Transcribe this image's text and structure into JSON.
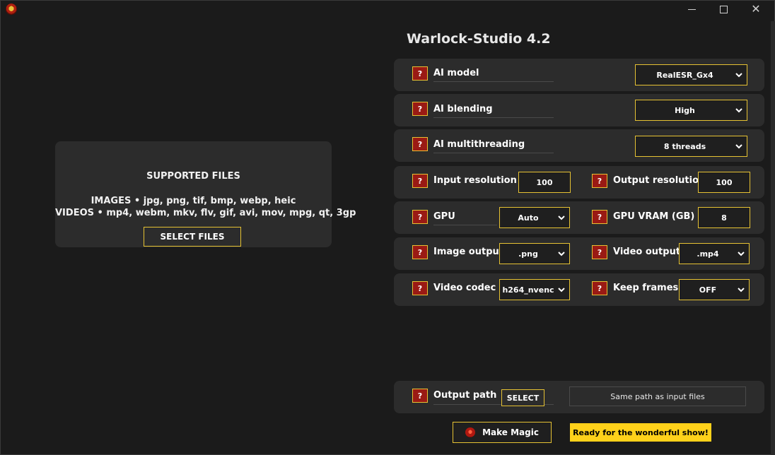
{
  "window": {
    "app_icon": "warlock-logo-icon",
    "controls": {
      "minimize": "minimize-icon",
      "maximize": "maximize-icon",
      "close": "close-icon"
    }
  },
  "drop_panel": {
    "title": "SUPPORTED FILES",
    "images_line": "IMAGES • jpg, png, tif, bmp, webp, heic",
    "videos_line": "VIDEOS • mp4, webm, mkv, flv, gif, avi, mov, mpg, qt, 3gp",
    "select_button": "SELECT FILES"
  },
  "app_title": "Warlock-Studio 4.2",
  "help_glyph": "?",
  "settings": {
    "ai_model": {
      "label": "AI model",
      "value": "RealESR_Gx4"
    },
    "ai_blending": {
      "label": "AI blending",
      "value": "High"
    },
    "ai_multithreading": {
      "label": "AI multithreading",
      "value": "8 threads"
    },
    "input_resolution": {
      "label": "Input resolution",
      "value": "100"
    },
    "output_resolution": {
      "label": "Output resolution",
      "value": "100"
    },
    "gpu": {
      "label": "GPU",
      "value": "Auto"
    },
    "gpu_vram": {
      "label": "GPU VRAM (GB)",
      "value": "8"
    },
    "image_output": {
      "label": "Image output",
      "value": ".png"
    },
    "video_output": {
      "label": "Video output",
      "value": ".mp4"
    },
    "video_codec": {
      "label": "Video codec",
      "value": "h264_nvenc"
    },
    "keep_frames": {
      "label": "Keep frames",
      "value": "OFF"
    }
  },
  "output_path": {
    "label": "Output path",
    "select_button": "SELECT",
    "value": "Same path as input files"
  },
  "actions": {
    "make_magic": "Make Magic",
    "make_magic_icon": "warlock-logo-icon",
    "status": "Ready for the wonderful show!"
  },
  "colors": {
    "background": "#1b1b1b",
    "panel": "#2c2c2c",
    "accent_border": "#e6c233",
    "help_red": "#9a1a14",
    "status_yellow": "#ffd11a"
  }
}
